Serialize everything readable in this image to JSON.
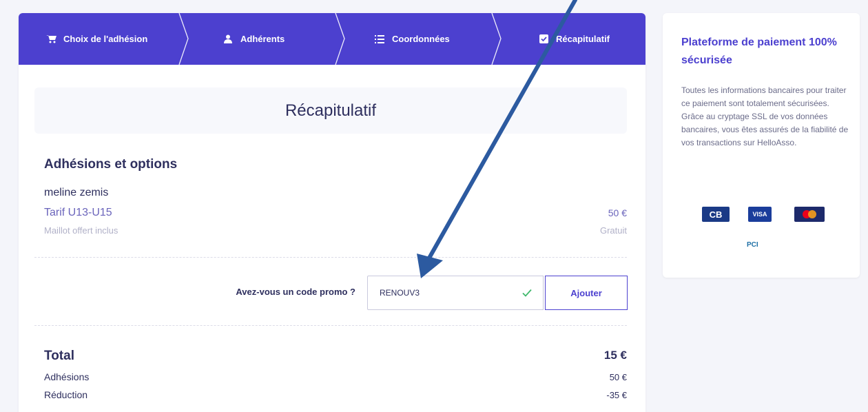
{
  "stepper": {
    "steps": [
      {
        "label": "Choix de l'adhésion",
        "icon": "cart-icon"
      },
      {
        "label": "Adhérents",
        "icon": "user-icon"
      },
      {
        "label": "Coordonnées",
        "icon": "list-icon"
      },
      {
        "label": "Récapitulatif",
        "icon": "checkbox-icon"
      }
    ]
  },
  "recap": {
    "title": "Récapitulatif",
    "section_title": "Adhésions et options",
    "member_name": "meline zemis",
    "tarif_label": "Tarif U13-U15",
    "tarif_price": "50 €",
    "option_label": "Maillot offert inclus",
    "option_price": "Gratuit"
  },
  "promo": {
    "question": "Avez-vous un code promo ?",
    "code_value": "RENOUV3",
    "add_label": "Ajouter"
  },
  "totals": {
    "total_label": "Total",
    "total_value": "15 €",
    "adhesions_label": "Adhésions",
    "adhesions_value": "50 €",
    "reduction_label": "Réduction",
    "reduction_value": "-35 €"
  },
  "sidebar": {
    "title": "Plateforme de paiement 100% sécurisée",
    "text": "Toutes les informations bancaires pour traiter ce paiement sont totalement sécurisées. Grâce au cryptage SSL de vos données bancaires, vous êtes assurés de la fiabilité de vos transactions sur HelloAsso.",
    "logos": {
      "cb": "CB",
      "visa": "VISA",
      "pci": "PCI"
    }
  },
  "colors": {
    "brand": "#4c40cf",
    "annotation_arrow": "#2c5aa0",
    "check": "#3fb86b"
  }
}
